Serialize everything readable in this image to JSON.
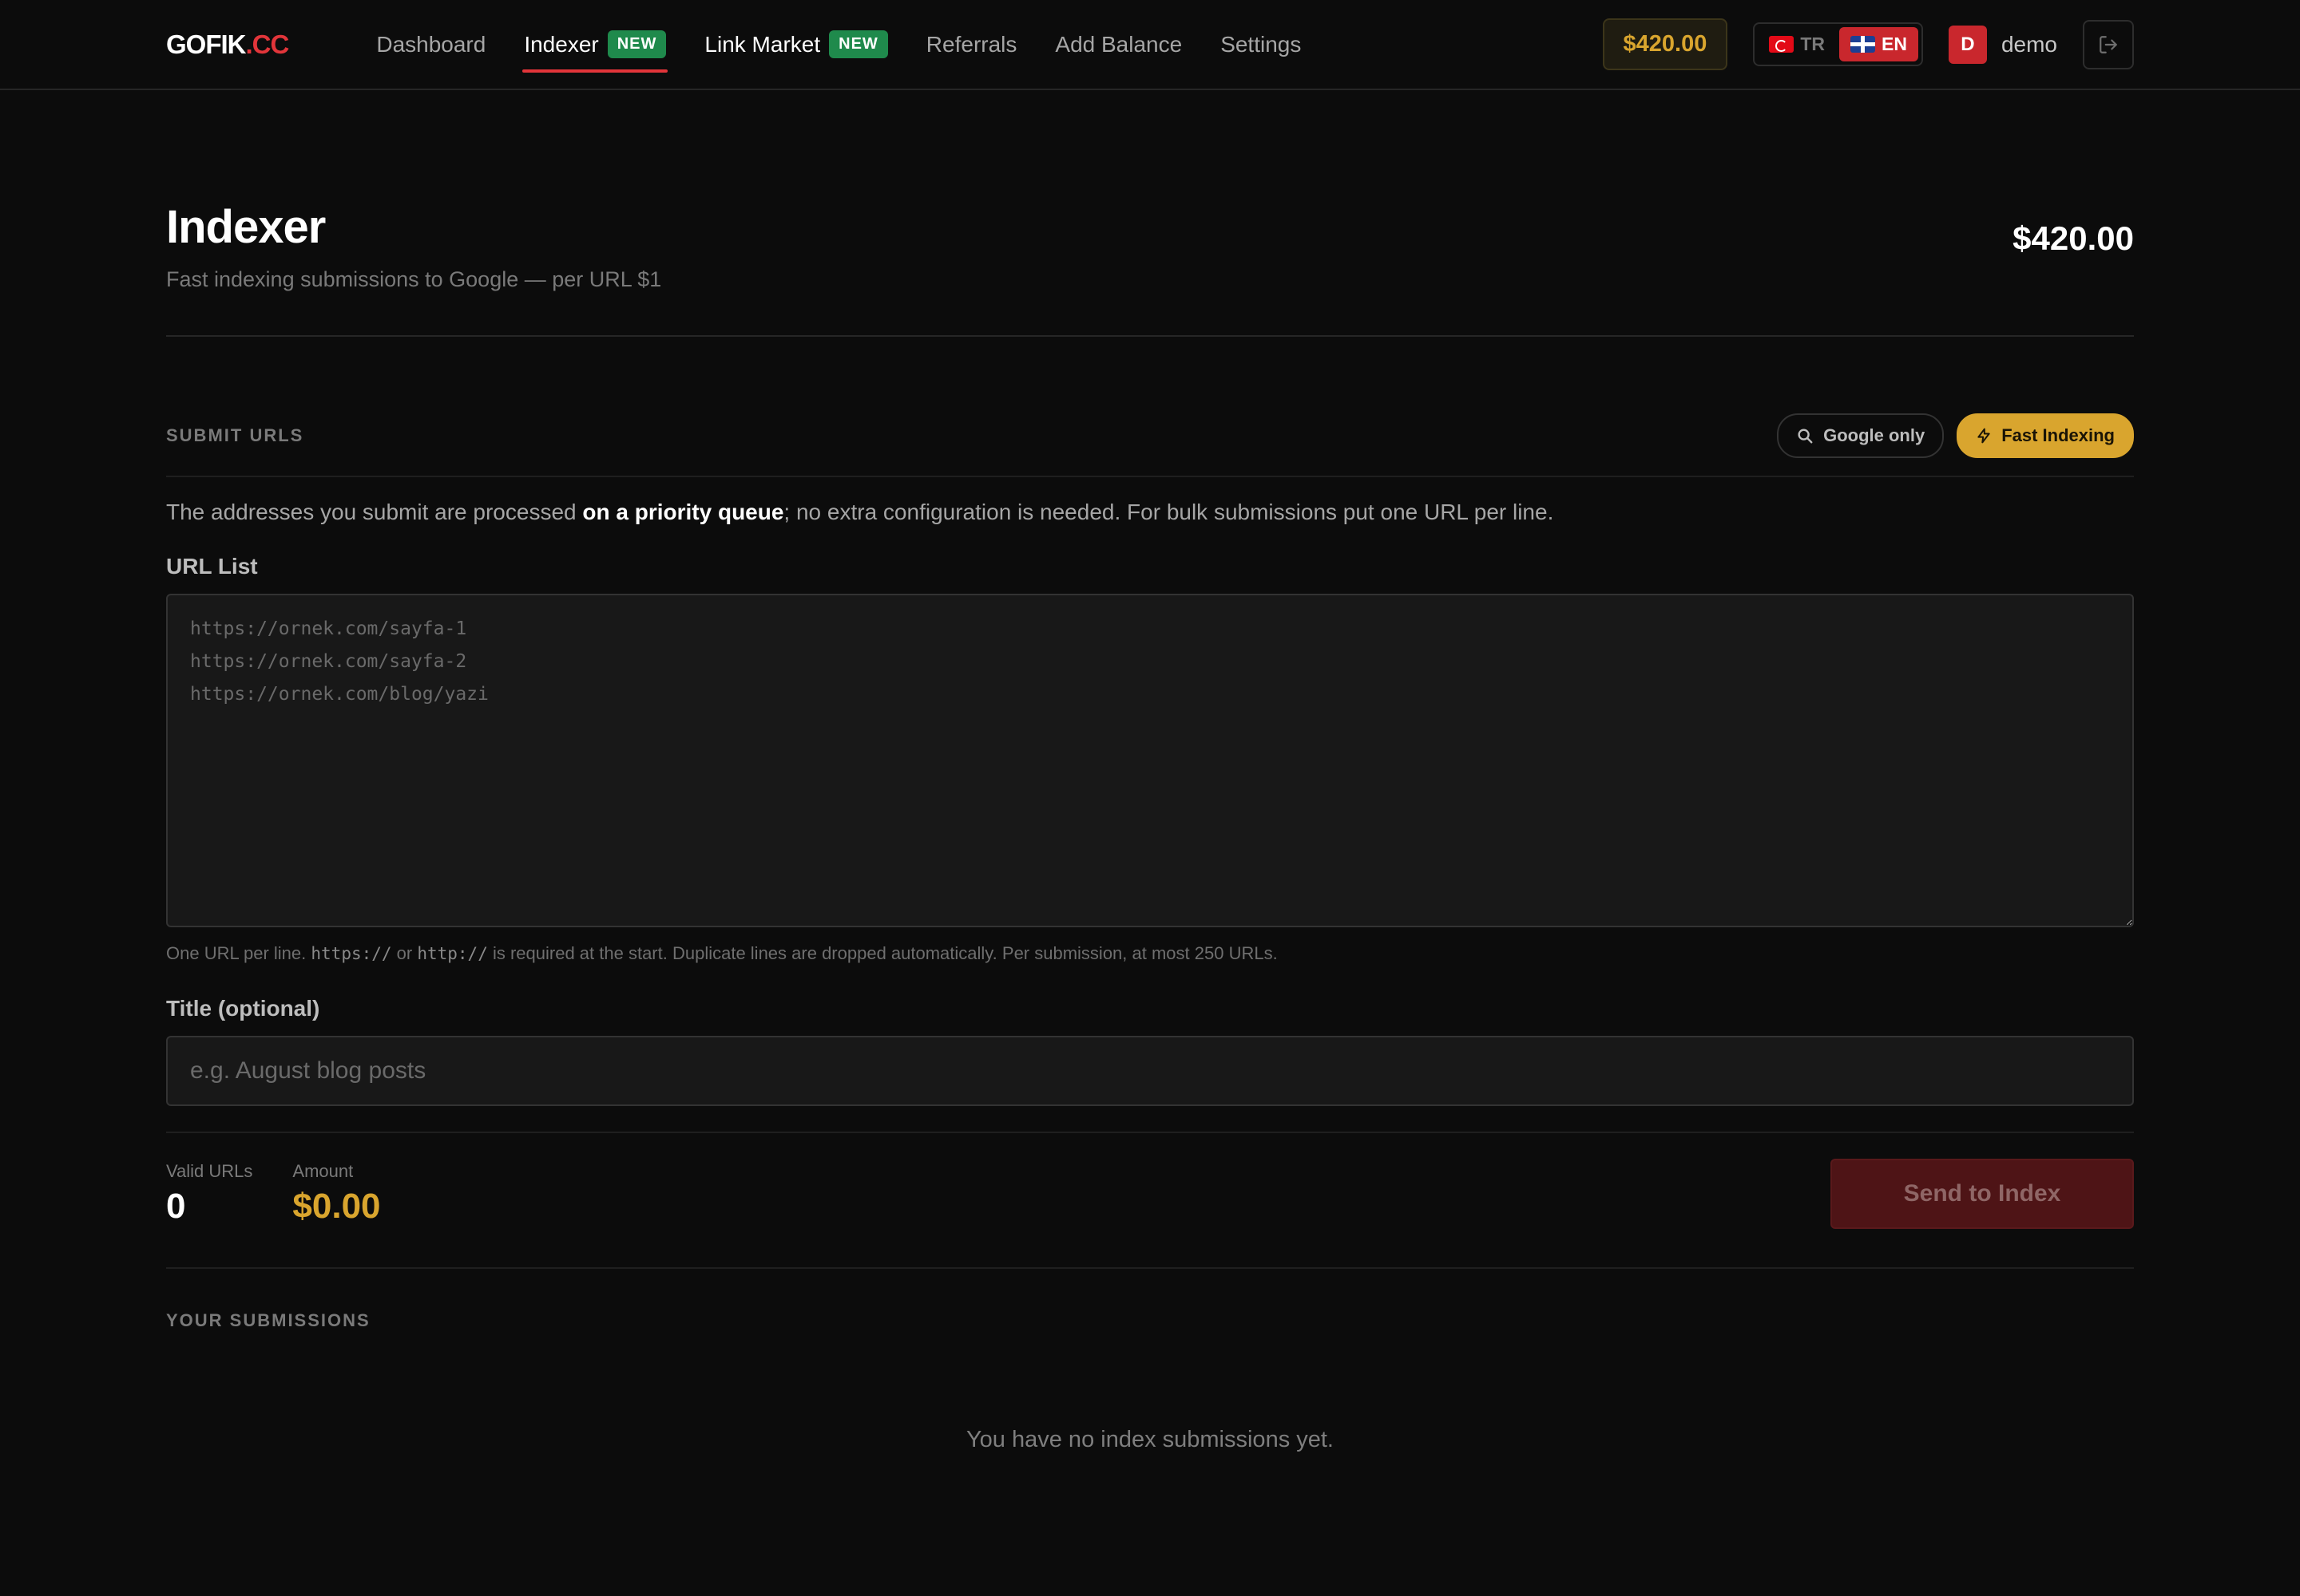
{
  "brand": {
    "name": "GOFIK",
    "accent": ".CC",
    "accent_color": "#e2353a"
  },
  "nav": {
    "items": [
      {
        "label": "Dashboard"
      },
      {
        "label": "Indexer",
        "badge": "NEW",
        "active": true
      },
      {
        "label": "Link Market",
        "badge": "NEW"
      },
      {
        "label": "Referrals"
      },
      {
        "label": "Add Balance"
      },
      {
        "label": "Settings"
      }
    ]
  },
  "topbar": {
    "balance": "$420.00",
    "languages": [
      {
        "code": "TR",
        "flag": "turkey-flag-icon",
        "active": false
      },
      {
        "code": "EN",
        "flag": "uk-flag-icon",
        "active": true
      }
    ],
    "user": {
      "initial": "D",
      "name": "demo"
    },
    "logout_icon": "logout-icon"
  },
  "page": {
    "title": "Indexer",
    "subtitle": "Fast indexing submissions to Google — per URL $1",
    "balance": "$420.00"
  },
  "submit": {
    "section_label": "SUBMIT URLS",
    "chips": {
      "google": {
        "label": "Google only",
        "icon": "search-icon"
      },
      "fast": {
        "label": "Fast Indexing",
        "icon": "lightning-icon"
      }
    },
    "intro_before": "The addresses you submit are processed ",
    "intro_strong": "on a priority queue",
    "intro_after": "; no extra configuration is needed. For bulk submissions put one URL per line.",
    "url_list_label": "URL List",
    "url_list_placeholder": "https://ornek.com/sayfa-1\nhttps://ornek.com/sayfa-2\nhttps://ornek.com/blog/yazi",
    "url_list_value": "",
    "hint_1": "One URL per line. ",
    "hint_code_1": "https://",
    "hint_2": " or ",
    "hint_code_2": "http://",
    "hint_3": " is required at the start. Duplicate lines are dropped automatically. Per submission, at most 250 URLs.",
    "title_label": "Title (optional)",
    "title_placeholder": "e.g. August blog posts",
    "title_value": ""
  },
  "summary": {
    "valid_label": "Valid URLs",
    "valid_value": "0",
    "amount_label": "Amount",
    "amount_value": "$0.00",
    "send_label": "Send to Index"
  },
  "submissions": {
    "section_label": "YOUR SUBMISSIONS",
    "empty_text": "You have no index submissions yet."
  },
  "colors": {
    "accent_red": "#e2353a",
    "gold": "#d9a52e",
    "badge_green": "#1f8a4c",
    "background": "#0c0c0c"
  }
}
